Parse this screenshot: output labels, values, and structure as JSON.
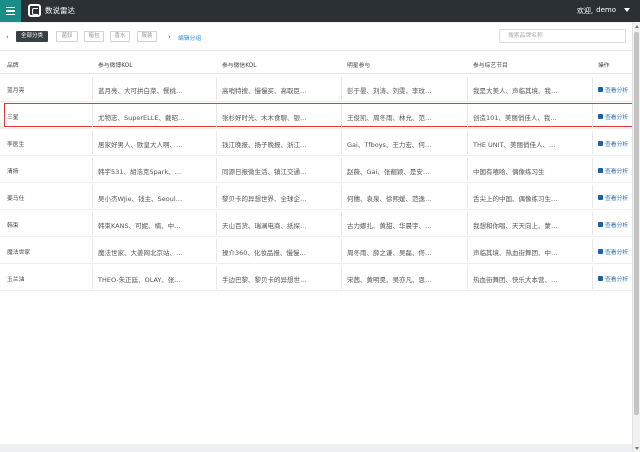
{
  "app": {
    "name": "数说雷达"
  },
  "user": {
    "greeting": "欢迎,",
    "name": "demo"
  },
  "filters": {
    "prev": "‹",
    "next": "›",
    "chips": [
      {
        "label": "全部分类",
        "active": true
      },
      {
        "label": "菌奴",
        "active": false
      },
      {
        "label": "箱包",
        "active": false
      },
      {
        "label": "香水",
        "active": false
      },
      {
        "label": "服装",
        "active": false
      }
    ],
    "edit_label": "编辑分组",
    "search_placeholder": "搜索品牌名称"
  },
  "table": {
    "headers": [
      "品牌",
      "参与微博KOL",
      "参与微信KOL",
      "明星参与",
      "参与综艺节目",
      "操作"
    ],
    "action_label": "查看分析",
    "rows": [
      {
        "brand": "蓝月亮",
        "weibo": "蓝月亮、大可拱白菜、餐桃…",
        "wechat": "高哨特搜、慢慢买、高取臣…",
        "star": "彭于晏、刘涛、刘雯、李玟…",
        "show": "我是大美人、声临其境、我…"
      },
      {
        "brand": "三星",
        "weibo": "尤物志、SuperELLE、戴昭…",
        "wechat": "张杉好时光、木木食聊、银…",
        "star": "王俊凯、周冬雨、林允、范…",
        "show": "创造101、美丽俏佳人、我…"
      },
      {
        "brand": "李医生",
        "weibo": "居家好男人、欧皇大人啊、…",
        "wechat": "钱江晚报、扬子晚报、浙江…",
        "star": "Gai、Tfboys、王力宏、何…",
        "show": "THE UNIT、美丽俏佳人、…"
      },
      {
        "brand": "清扬",
        "weibo": "韩宇531、胡浩克Spark、…",
        "wechat": "同源日报微生活、镇江交通…",
        "star": "赵薇、Gai、张靓颖、是安…",
        "show": "中国有嘻哈、偶像练习生"
      },
      {
        "brand": "姜马仕",
        "weibo": "吴小杰WJie、钱主、Seoul…",
        "wechat": "黎贝卡的异想世界、全球企…",
        "star": "何穗、袁泉、徐熙媛、范逸…",
        "show": "舌尖上的中国、偶像练习生…"
      },
      {
        "brand": "韩束",
        "weibo": "韩束KANS、可妮、楠、中…",
        "wechat": "天山百货、瑞澜电商、纸探…",
        "star": "古力娜扎、黄甜、华晨宇、…",
        "show": "我想和你唱、天天向上、蒙…"
      },
      {
        "brand": "魔法世家",
        "weibo": "魔法世家、大姜网北京站、…",
        "wechat": "操介360、化妆品报、慢慢…",
        "star": "周冬雨、薛之谦、吴磊、佟…",
        "show": "声临其境、热血街舞团、中…"
      },
      {
        "brand": "玉兰油",
        "weibo": "THEO-朱正廷、OLAY、张…",
        "wechat": "手边巴黎、黎贝卡的异想世…",
        "star": "宋茜、黄明昊、吴亦凡、恩…",
        "show": "热血街舞团、快乐大本营、…"
      }
    ],
    "highlighted_row": 1
  },
  "colors": {
    "topbar": "#2b3035",
    "menu_accent": "#1c8c86",
    "link": "#2e8fd0",
    "highlight_border": "#e23a3a"
  }
}
